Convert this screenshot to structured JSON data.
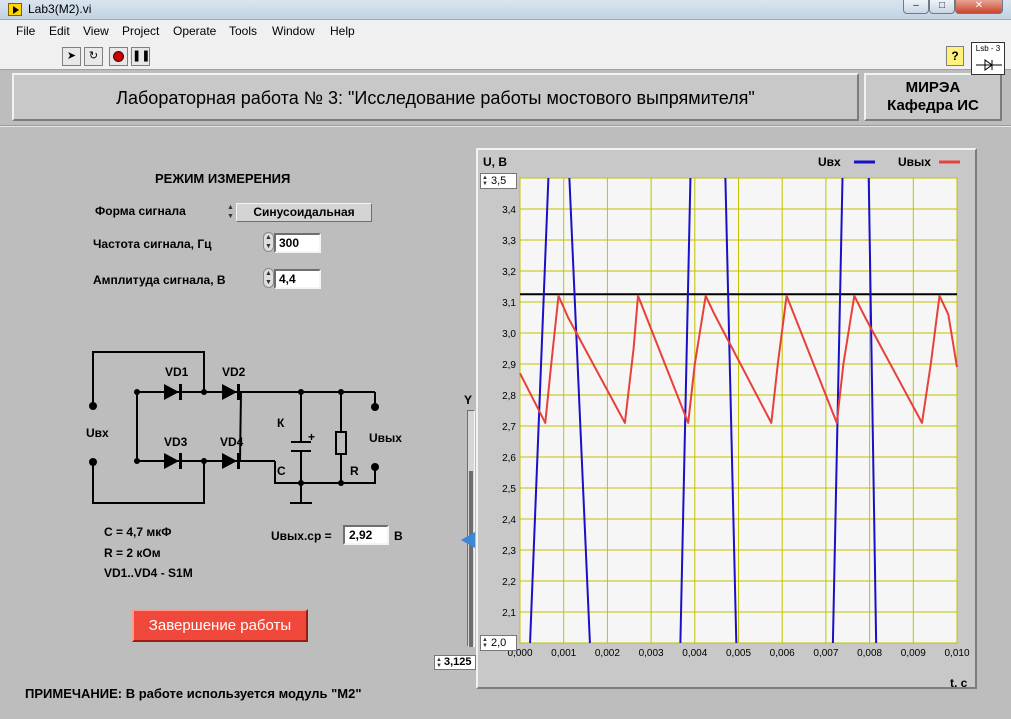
{
  "window": {
    "title": "Lab3(M2).vi",
    "vi_icon_label": "Lsb - 3"
  },
  "menu": [
    "File",
    "Edit",
    "View",
    "Project",
    "Operate",
    "Tools",
    "Window",
    "Help"
  ],
  "header": {
    "title": "Лабораторная работа № 3: \"Исследование работы мостового выпрямителя\"",
    "org_name": "МИРЭА",
    "org_dept": "Кафедра ИС"
  },
  "controls": {
    "mode_title": "РЕЖИМ ИЗМЕРЕНИЯ",
    "signal_shape_label": "Форма сигнала",
    "signal_shape_value": "Синусоидальная",
    "frequency_label": "Частота сигнала, Гц",
    "frequency_value": "300",
    "amplitude_label": "Амплитуда сигнала, В",
    "amplitude_value": "4,4"
  },
  "circuit": {
    "uin": "Uвх",
    "uout": "Uвых",
    "vd1": "VD1",
    "vd2": "VD2",
    "vd3": "VD3",
    "vd4": "VD4",
    "k": "К",
    "c": "С",
    "r": "R",
    "plus": "+"
  },
  "params": {
    "c_line": "С =   4,7 мкФ",
    "r_line": "R = 2 кОм",
    "vd_line": "VD1..VD4 - S1M"
  },
  "uavg": {
    "label": "Uвых.ср =",
    "value": "2,92",
    "unit": "В"
  },
  "finish_button": "Завершение работы",
  "note": "ПРИМЕЧАНИЕ: В работе используется модуль \"М2\"",
  "slider": {
    "label": "Y",
    "value": 3.125,
    "display": "3,125",
    "range": [
      2.0,
      3.5
    ]
  },
  "colors": {
    "uin": "#1a10c8",
    "uout": "#e8403a",
    "ref_line": "#000000",
    "grid": "#c2c200",
    "finish": "#f0493c"
  },
  "chart_data": {
    "type": "line",
    "ylabel": "U, В",
    "xlabel": "t, с",
    "xlim": [
      0.0,
      0.01
    ],
    "ylim": [
      2.0,
      3.5
    ],
    "y_top_display": "3,5",
    "y_bottom_display": "2,0",
    "x_ticks": [
      "0,000",
      "0,001",
      "0,002",
      "0,003",
      "0,004",
      "0,005",
      "0,006",
      "0,007",
      "0,008",
      "0,009",
      "0,010"
    ],
    "y_ticks": [
      "2,0",
      "2,1",
      "2,2",
      "2,3",
      "2,4",
      "2,5",
      "2,6",
      "2,7",
      "2,8",
      "2,9",
      "3,0",
      "3,1",
      "3,2",
      "3,3",
      "3,4",
      "3,5"
    ],
    "legend": [
      "Uвх",
      "Uвых"
    ],
    "reference_line": 3.125,
    "uin_crossings": [
      [
        [
          0.00023,
          2.0
        ],
        [
          0.00065,
          3.5
        ]
      ],
      [
        [
          0.00113,
          3.5
        ],
        [
          0.0016,
          2.0
        ]
      ],
      [
        [
          0.00367,
          2.0
        ],
        [
          0.0039,
          3.5
        ]
      ],
      [
        [
          0.0047,
          3.5
        ],
        [
          0.00495,
          2.0
        ]
      ],
      [
        [
          0.00716,
          2.0
        ],
        [
          0.00738,
          3.5
        ]
      ],
      [
        [
          0.00798,
          3.5
        ],
        [
          0.00815,
          2.0
        ]
      ]
    ],
    "series": [
      {
        "name": "Uвых",
        "points": [
          [
            0.0,
            2.87
          ],
          [
            0.00058,
            2.71
          ],
          [
            0.0007,
            2.88
          ],
          [
            0.00088,
            3.12
          ],
          [
            0.0011,
            3.05
          ],
          [
            0.0024,
            2.71
          ],
          [
            0.0026,
            2.95
          ],
          [
            0.0027,
            3.12
          ],
          [
            0.00385,
            2.71
          ],
          [
            0.004,
            2.9
          ],
          [
            0.00425,
            3.12
          ],
          [
            0.00445,
            3.06
          ],
          [
            0.00575,
            2.71
          ],
          [
            0.0059,
            2.9
          ],
          [
            0.0061,
            3.12
          ],
          [
            0.00725,
            2.71
          ],
          [
            0.0074,
            2.9
          ],
          [
            0.00765,
            3.12
          ],
          [
            0.0079,
            3.05
          ],
          [
            0.0092,
            2.71
          ],
          [
            0.0094,
            2.9
          ],
          [
            0.0096,
            3.12
          ],
          [
            0.0098,
            3.06
          ],
          [
            0.01,
            2.89
          ]
        ]
      }
    ]
  }
}
